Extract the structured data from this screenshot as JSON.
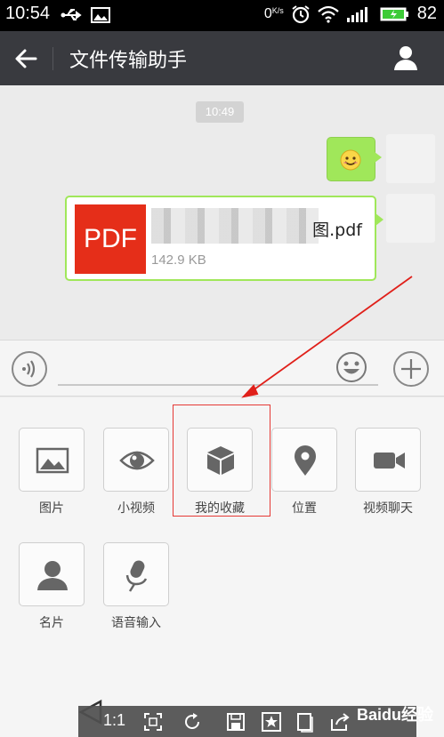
{
  "status_bar": {
    "time": "10:54",
    "network_speed": "0",
    "network_unit": "K/s",
    "battery": "82"
  },
  "header": {
    "title": "文件传输助手"
  },
  "chat": {
    "timestamp": "10:49",
    "file": {
      "icon_label": "PDF",
      "name_suffix": "图.pdf",
      "size": "142.9 KB"
    }
  },
  "panel": {
    "items": [
      {
        "label": "图片",
        "icon": "image-icon"
      },
      {
        "label": "小视频",
        "icon": "eye-icon"
      },
      {
        "label": "我的收藏",
        "icon": "cube-icon"
      },
      {
        "label": "位置",
        "icon": "location-pin-icon"
      },
      {
        "label": "视频聊天",
        "icon": "video-camera-icon"
      },
      {
        "label": "名片",
        "icon": "person-card-icon"
      },
      {
        "label": "语音输入",
        "icon": "microphone-icon"
      }
    ]
  },
  "viewer_toolbar": {
    "zoom_label": "1:1",
    "watermark": "Baidu经验"
  },
  "colors": {
    "title_bar": "#393a3f",
    "bubble_green": "#a0e75a",
    "pdf_red": "#e52e19",
    "highlight_red": "#e53935"
  }
}
